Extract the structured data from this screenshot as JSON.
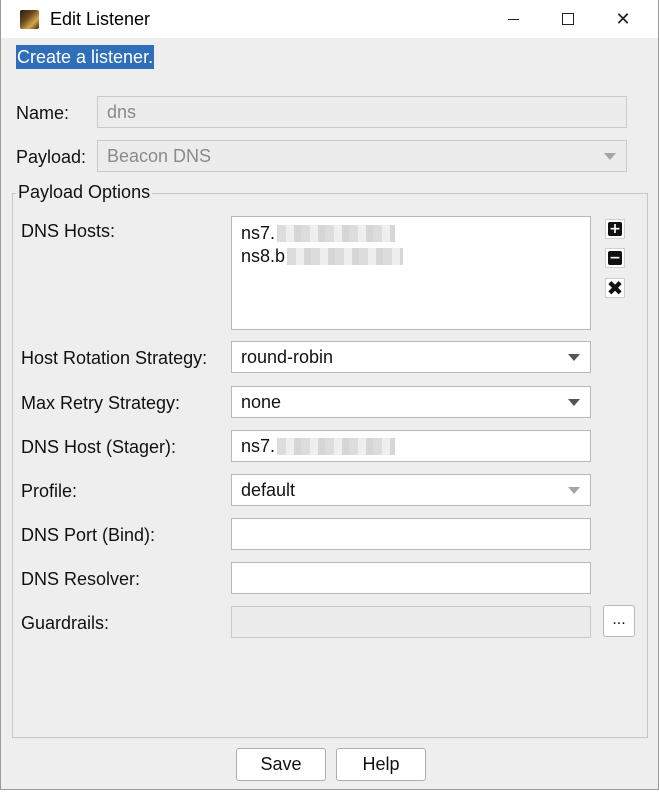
{
  "window": {
    "title": "Edit Listener",
    "minimize_glyph": "",
    "maximize_glyph": "",
    "close_glyph": "✕"
  },
  "banner": {
    "text": "Create a listener."
  },
  "form": {
    "name_label": "Name:",
    "name_value": "dns",
    "payload_label": "Payload:",
    "payload_value": "Beacon DNS",
    "group_title": "Payload Options",
    "dns_hosts_label": "DNS Hosts:",
    "dns_hosts": [
      "ns7.",
      "ns8.b"
    ],
    "host_rotation_label": "Host Rotation Strategy:",
    "host_rotation_value": "round-robin",
    "max_retry_label": "Max Retry Strategy:",
    "max_retry_value": "none",
    "dns_host_stager_label": "DNS Host (Stager):",
    "dns_host_stager_value": "ns7.",
    "profile_label": "Profile:",
    "profile_value": "default",
    "dns_port_label": "DNS Port (Bind):",
    "dns_port_value": "",
    "dns_resolver_label": "DNS Resolver:",
    "dns_resolver_value": "",
    "guardrails_label": "Guardrails:",
    "guardrails_value": "",
    "guardrails_button": "...",
    "add_glyph": "+",
    "remove_glyph": "−",
    "clear_glyph": "✖"
  },
  "buttons": {
    "save": "Save",
    "help": "Help"
  },
  "icons": [
    "app-icon",
    "minimize-icon",
    "maximize-icon",
    "close-icon",
    "add-host-icon",
    "remove-host-icon",
    "clear-hosts-icon",
    "chevron-down-icon"
  ],
  "colors": {
    "accent": "#2f6fba",
    "background": "#eeeeee"
  }
}
